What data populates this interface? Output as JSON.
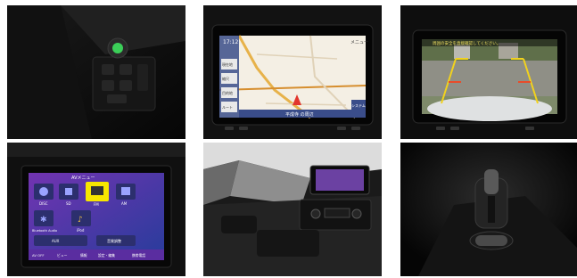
{
  "gallery": {
    "nav_screen": {
      "clock": "17:12",
      "right_menu": "メニュー",
      "side_buttons": [
        "現在地",
        "縮尺",
        "目的地",
        "ルート"
      ],
      "bottom_bar": "平成寺 の周辺",
      "system_label": "システム"
    },
    "backup_camera": {
      "warning_text": "周囲の安全を直接確認してください。"
    },
    "av_menu": {
      "title": "AVメニュー",
      "sources": [
        {
          "icon": "disc-icon",
          "label": "DISC"
        },
        {
          "icon": "sd-icon",
          "label": "SD"
        },
        {
          "icon": "fm-radio-icon",
          "label": "FM"
        },
        {
          "icon": "am-radio-icon",
          "label": "AM"
        },
        {
          "icon": "bluetooth-icon",
          "label": "Bluetooth Audio"
        },
        {
          "icon": "ipod-icon",
          "label": "iPod"
        },
        {
          "icon": "tv-icon",
          "label": ""
        },
        {
          "icon": "hdmi-icon",
          "label": ""
        }
      ],
      "aux_label": "AUX",
      "settings_label": "音質調整",
      "bottom_bar": [
        "AV OFF",
        "ビュー",
        "情報",
        "設定・編集",
        "携帯電話"
      ],
      "accent_color": "#f7e600"
    }
  }
}
